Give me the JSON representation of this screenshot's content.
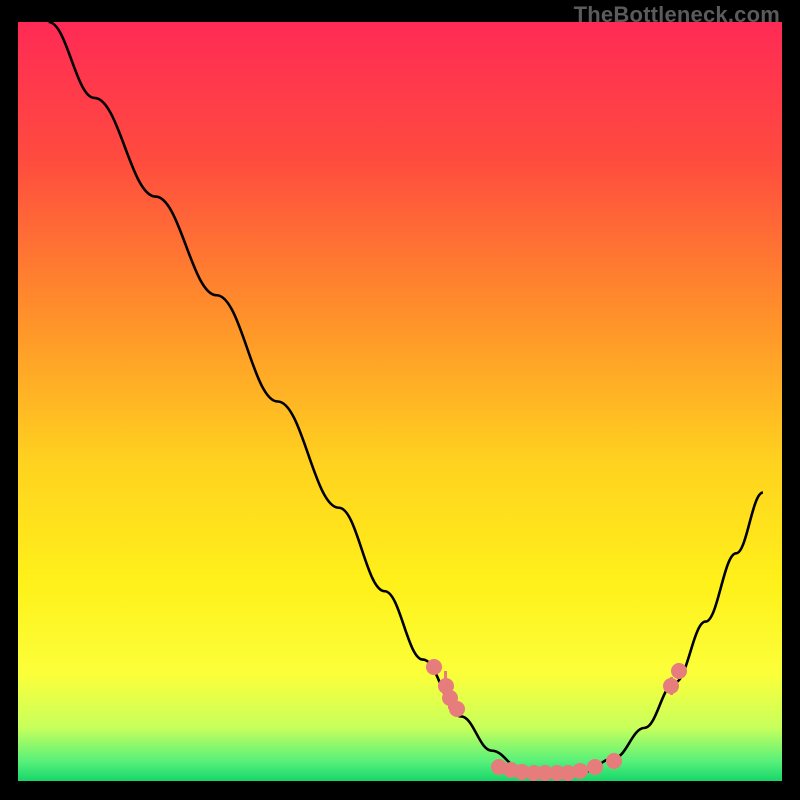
{
  "watermark": "TheBottleneck.com",
  "colors": {
    "background": "#000000",
    "gradient_stops": [
      {
        "offset": 0.0,
        "color": "#ff2a55"
      },
      {
        "offset": 0.18,
        "color": "#ff4b3f"
      },
      {
        "offset": 0.38,
        "color": "#ff8e2b"
      },
      {
        "offset": 0.58,
        "color": "#ffd21f"
      },
      {
        "offset": 0.74,
        "color": "#fff11a"
      },
      {
        "offset": 0.86,
        "color": "#fbff3a"
      },
      {
        "offset": 0.93,
        "color": "#c7ff5c"
      },
      {
        "offset": 0.975,
        "color": "#55f07a"
      },
      {
        "offset": 1.0,
        "color": "#17d66a"
      }
    ],
    "curve": "#000000",
    "marker": "#e77c7c"
  },
  "chart_data": {
    "type": "line",
    "title": "",
    "xlabel": "",
    "ylabel": "",
    "xlim": [
      0,
      100
    ],
    "ylim": [
      0,
      100
    ],
    "curve": [
      {
        "x": 4.0,
        "y": 100.0
      },
      {
        "x": 10.0,
        "y": 90.0
      },
      {
        "x": 18.0,
        "y": 77.0
      },
      {
        "x": 26.0,
        "y": 64.0
      },
      {
        "x": 34.0,
        "y": 50.0
      },
      {
        "x": 42.0,
        "y": 36.0
      },
      {
        "x": 48.0,
        "y": 25.0
      },
      {
        "x": 53.0,
        "y": 16.0
      },
      {
        "x": 58.0,
        "y": 8.5
      },
      {
        "x": 62.0,
        "y": 4.0
      },
      {
        "x": 66.0,
        "y": 1.5
      },
      {
        "x": 70.0,
        "y": 0.6
      },
      {
        "x": 74.0,
        "y": 1.2
      },
      {
        "x": 78.0,
        "y": 3.0
      },
      {
        "x": 82.0,
        "y": 7.0
      },
      {
        "x": 86.0,
        "y": 13.0
      },
      {
        "x": 90.0,
        "y": 21.0
      },
      {
        "x": 94.0,
        "y": 30.0
      },
      {
        "x": 97.5,
        "y": 38.0
      }
    ],
    "series": [
      {
        "name": "markers",
        "points": [
          {
            "x": 54.5,
            "y": 15.0,
            "err": 0.8
          },
          {
            "x": 56.0,
            "y": 12.5,
            "err": 2.0
          },
          {
            "x": 56.5,
            "y": 11.0,
            "err": 1.5
          },
          {
            "x": 57.5,
            "y": 9.5,
            "err": 0.5
          },
          {
            "x": 63.0,
            "y": 1.8,
            "err": 0.5
          },
          {
            "x": 64.5,
            "y": 1.4,
            "err": 0.4
          },
          {
            "x": 66.0,
            "y": 1.2,
            "err": 0.4
          },
          {
            "x": 67.5,
            "y": 1.0,
            "err": 0.4
          },
          {
            "x": 69.0,
            "y": 1.0,
            "err": 0.4
          },
          {
            "x": 70.5,
            "y": 1.0,
            "err": 0.4
          },
          {
            "x": 72.0,
            "y": 1.1,
            "err": 0.4
          },
          {
            "x": 73.5,
            "y": 1.3,
            "err": 0.4
          },
          {
            "x": 75.5,
            "y": 1.8,
            "err": 0.4
          },
          {
            "x": 78.0,
            "y": 2.6,
            "err": 0.4
          },
          {
            "x": 85.5,
            "y": 12.5,
            "err": 1.2
          },
          {
            "x": 86.5,
            "y": 14.5,
            "err": 1.0
          }
        ]
      }
    ]
  }
}
